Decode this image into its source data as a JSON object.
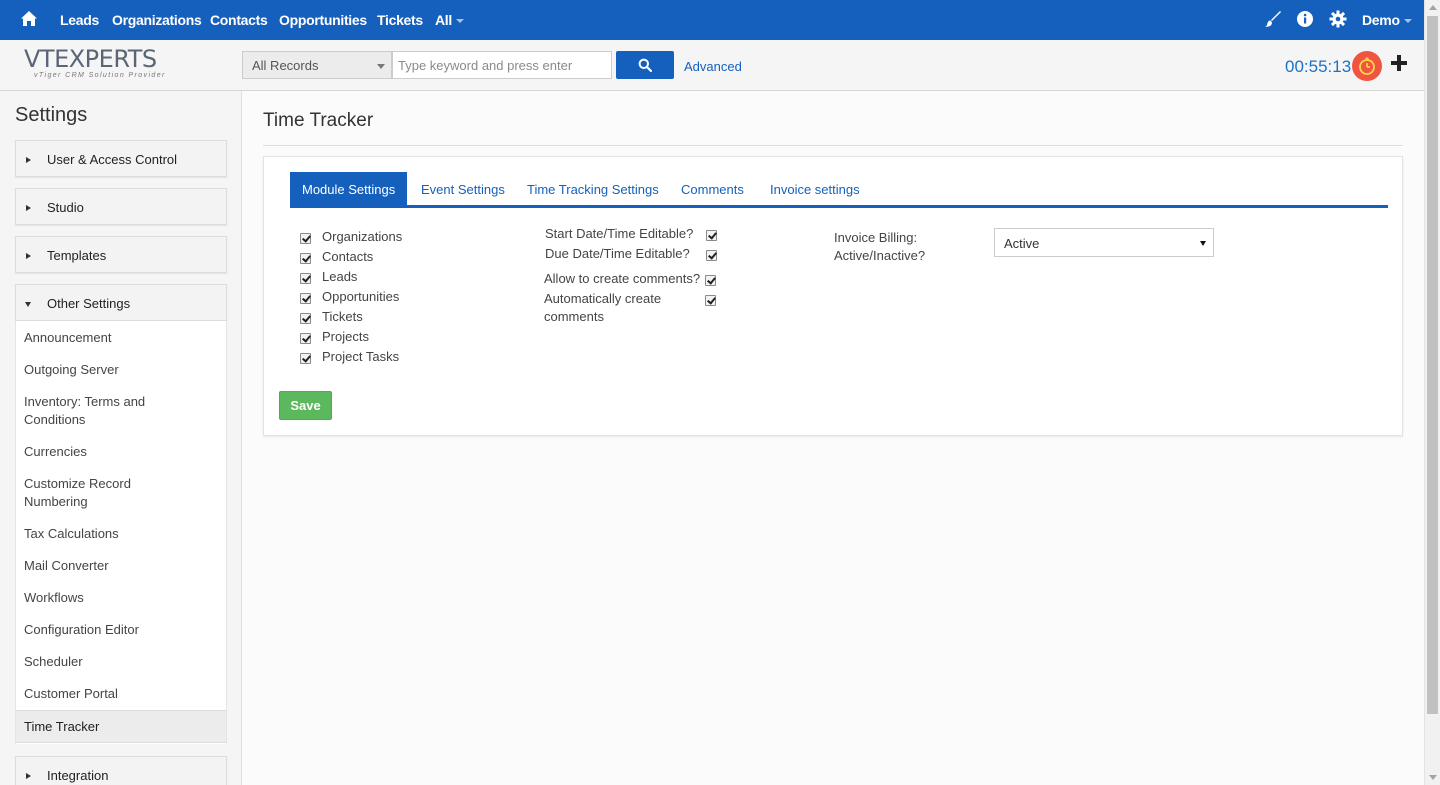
{
  "topnav": {
    "home_icon": "home-icon",
    "links": [
      "Leads",
      "Organizations",
      "Contacts",
      "Opportunities",
      "Tickets",
      "All"
    ],
    "user": "Demo",
    "icons": [
      "brush-icon",
      "info-icon",
      "gear-icon"
    ],
    "bg_color": "#1560bd"
  },
  "header": {
    "logo_text": "VTEXPERTS",
    "logo_tagline": "vTiger CRM Solution Provider",
    "records_select": "All Records",
    "search_placeholder": "Type keyword and press enter",
    "advanced": "Advanced",
    "timer": "00:55:13"
  },
  "sidebar": {
    "title": "Settings",
    "groups": [
      "User & Access Control",
      "Studio",
      "Templates",
      "Other Settings",
      "Integration"
    ],
    "items": [
      "Announcement",
      "Outgoing Server",
      "Inventory: Terms and Conditions",
      "Currencies",
      "Customize Record Numbering",
      "Tax Calculations",
      "Mail Converter",
      "Workflows",
      "Configuration Editor",
      "Scheduler",
      "Customer Portal",
      "Time Tracker"
    ],
    "active_item": "Time Tracker"
  },
  "main": {
    "title": "Time Tracker",
    "tabs": [
      "Module Settings",
      "Event Settings",
      "Time Tracking Settings",
      "Comments",
      "Invoice settings"
    ],
    "active_tab": "Module Settings",
    "modules": [
      "Organizations",
      "Contacts",
      "Leads",
      "Opportunities",
      "Tickets",
      "Projects",
      "Project Tasks"
    ],
    "options": [
      "Start Date/Time Editable?",
      "Due Date/Time Editable?",
      "Allow to create comments?",
      "Automatically create comments"
    ],
    "invoice_billing_label": "Invoice Billing: Active/Inactive?",
    "invoice_billing_value": "Active",
    "save": "Save"
  }
}
